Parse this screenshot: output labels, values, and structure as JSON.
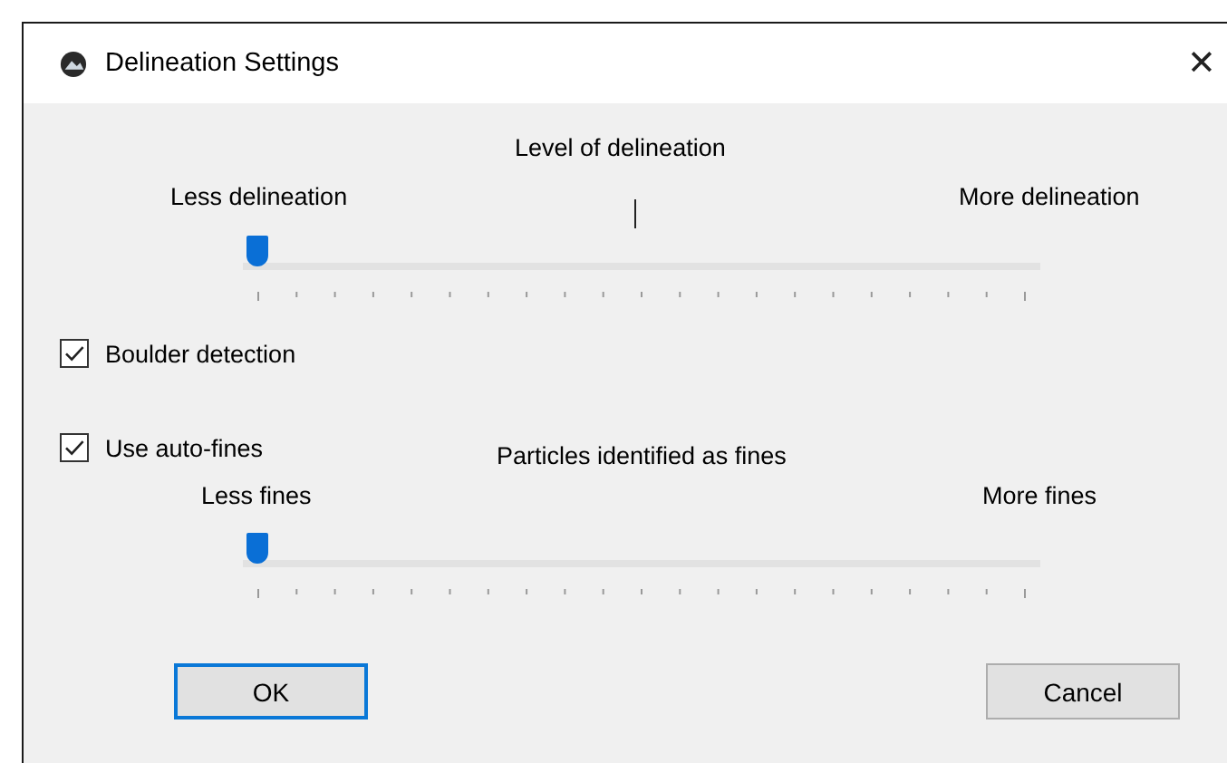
{
  "window": {
    "title": "Delineation Settings",
    "close": "✕"
  },
  "sliders": [
    {
      "title": "Level of delineation",
      "min_label": "Less delineation",
      "max_label": "More delineation",
      "level": 0
    },
    {
      "title": "Particles identified as fines",
      "min_label": "Less fines",
      "max_label": "More fines",
      "level": 0
    }
  ],
  "checkboxes": [
    {
      "label": "Boulder detection",
      "checked": true
    },
    {
      "label": "Use auto-fines",
      "checked": true
    }
  ],
  "buttons": [
    {
      "label": "OK",
      "default": true
    },
    {
      "label": "Cancel",
      "default": false
    }
  ]
}
